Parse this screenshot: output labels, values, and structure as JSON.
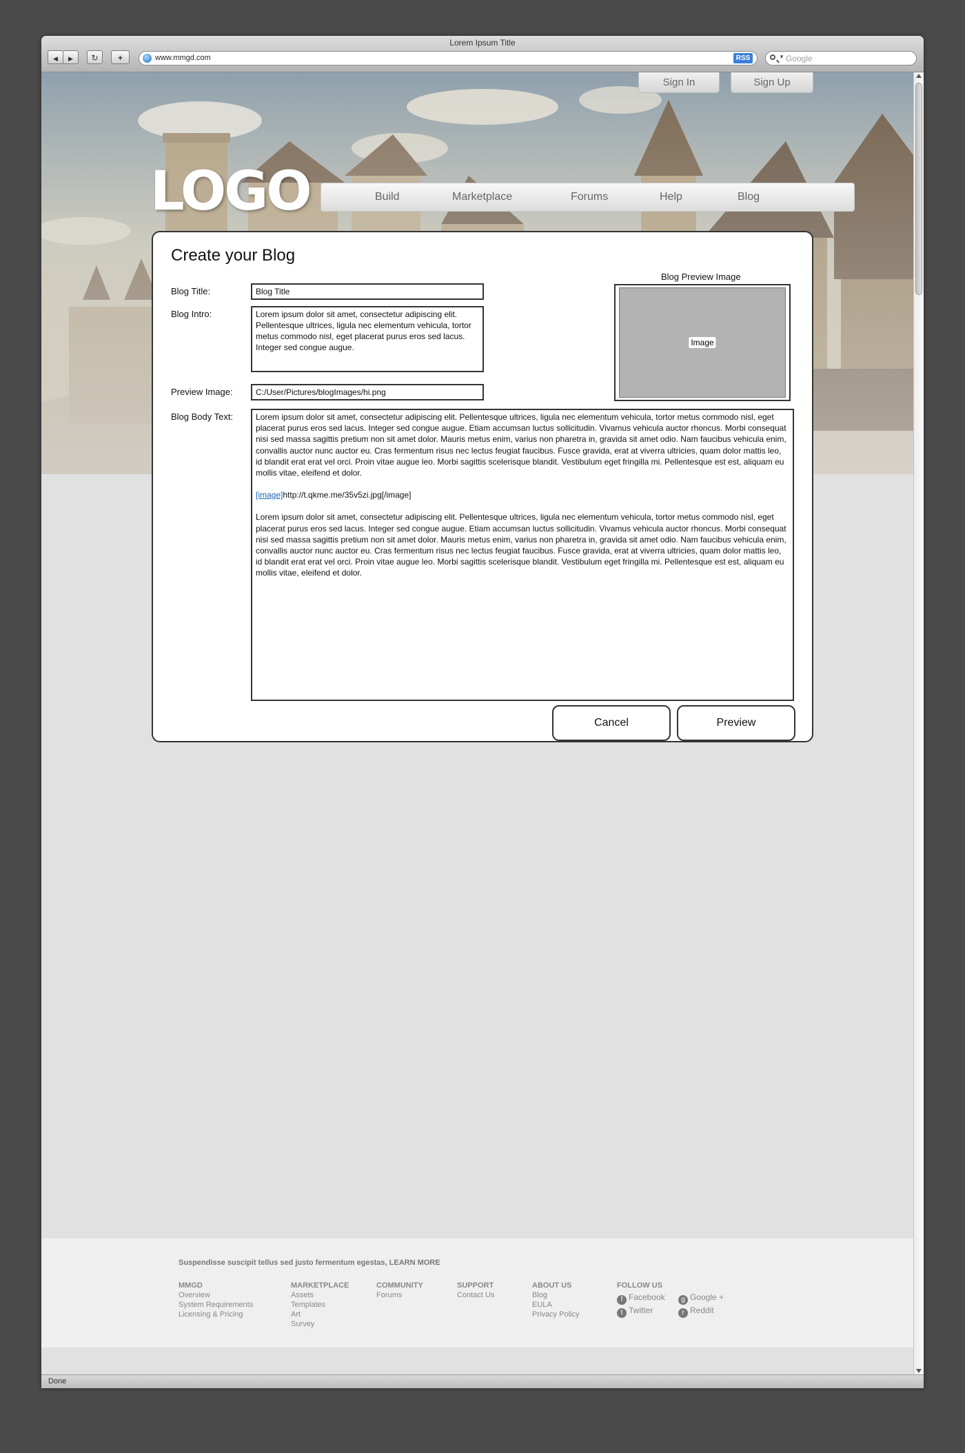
{
  "browser": {
    "window_title": "Lorem Ipsum Title",
    "url": "www.mmgd.com",
    "rss_label": "RSS",
    "search_placeholder": "Google",
    "status": "Done",
    "nav_buttons": {
      "back": "◀",
      "forward": "▶",
      "reload": "↻",
      "new_tab": "+"
    }
  },
  "header": {
    "sign_in": "Sign In",
    "sign_up": "Sign Up",
    "logo": "LOGO",
    "nav": [
      "Build",
      "Marketplace",
      "Forums",
      "Help",
      "Blog"
    ]
  },
  "form": {
    "title": "Create your Blog",
    "labels": {
      "blog_title": "Blog Title:",
      "blog_intro": "Blog Intro:",
      "preview_image": "Preview Image:",
      "body_text": "Blog Body Text:"
    },
    "blog_title_value": "Blog Title",
    "blog_intro_value": "Lorem ipsum dolor sit amet, consectetur adipiscing elit. Pellentesque ultrices, ligula nec elementum vehicula, tortor metus commodo nisl, eget placerat purus eros sed lacus. Integer sed congue augue.",
    "preview_image_value": "C:/User/Pictures/blogImages/hi.png",
    "preview_heading": "Blog Preview Image",
    "preview_placeholder": "Image",
    "body": {
      "paragraph1": "Lorem ipsum dolor sit amet, consectetur adipiscing elit. Pellentesque ultrices, ligula nec elementum vehicula, tortor metus commodo nisl, eget placerat purus eros sed lacus. Integer sed congue augue. Etiam accumsan luctus sollicitudin. Vivamus vehicula auctor rhoncus. Morbi consequat nisi sed massa sagittis pretium non sit amet dolor. Mauris metus enim, varius non pharetra in, gravida sit amet odio. Nam faucibus vehicula enim, convallis auctor nunc auctor eu. Cras fermentum risus nec lectus feugiat faucibus. Fusce gravida, erat at viverra ultricies, quam dolor mattis leo, id blandit erat erat vel orci. Proin vitae augue leo. Morbi sagittis scelerisque blandit. Vestibulum eget fringilla mi. Pellentesque est est, aliquam eu mollis vitae, eleifend et dolor.",
      "image_tag_open": "[image]",
      "image_url_rest": "http://t.qkme.me/35v5zi.jpg[/image]",
      "paragraph2": "Lorem ipsum dolor sit amet, consectetur adipiscing elit. Pellentesque ultrices, ligula nec elementum vehicula, tortor metus commodo nisl, eget placerat purus eros sed lacus. Integer sed congue augue. Etiam accumsan luctus sollicitudin. Vivamus vehicula auctor rhoncus. Morbi consequat nisi sed massa sagittis pretium non sit amet dolor. Mauris metus enim, varius non pharetra in, gravida sit amet odio. Nam faucibus vehicula enim, convallis auctor nunc auctor eu. Cras fermentum risus nec lectus feugiat faucibus. Fusce gravida, erat at viverra ultricies, quam dolor mattis leo, id blandit erat erat vel orci. Proin vitae augue leo. Morbi sagittis scelerisque blandit. Vestibulum eget fringilla mi. Pellentesque est est, aliquam eu mollis vitae, eleifend et dolor."
    },
    "cancel": "Cancel",
    "preview": "Preview"
  },
  "footer": {
    "note": "Suspendisse suscipit tellus sed justo fermentum egestas, LEARN MORE",
    "columns": [
      {
        "heading": "MMGD",
        "links": [
          "Overview",
          "System Requirements",
          "Licensing & Pricing"
        ]
      },
      {
        "heading": "MARKETPLACE",
        "links": [
          "Assets",
          "Templates",
          "Art",
          "Survey"
        ]
      },
      {
        "heading": "COMMUNITY",
        "links": [
          "Forums"
        ]
      },
      {
        "heading": "SUPPORT",
        "links": [
          "Contact Us"
        ]
      },
      {
        "heading": "ABOUT US",
        "links": [
          "Blog",
          "EULA",
          "Privacy Policy"
        ]
      }
    ],
    "follow_heading": "FOLLOW US",
    "social": [
      {
        "label": "Facebook",
        "icon": "facebook-icon"
      },
      {
        "label": "Google +",
        "icon": "google-plus-icon"
      },
      {
        "label": "Twitter",
        "icon": "twitter-icon"
      },
      {
        "label": "Reddit",
        "icon": "reddit-icon"
      }
    ]
  }
}
